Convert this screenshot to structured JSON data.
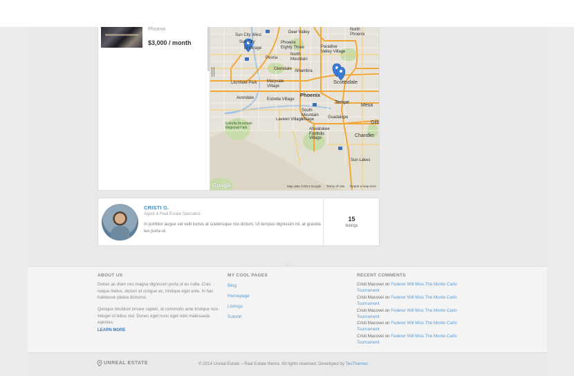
{
  "listing": {
    "location": "Phoenix",
    "price": "$3,000 / month"
  },
  "map": {
    "labels": {
      "sun_city_west": "Sun City West",
      "sun_city": "Sun City",
      "deer_valley": "Deer Valley",
      "north_phoenix": "North\nPhoenix",
      "phoenix_eighty_three": "Phoenix\nEighty Three",
      "paradise_valley_village": "Paradise\nValley Village",
      "el_mirage": "El Mirage",
      "peoria": "Peoria",
      "north_mountain": "North\nMountain",
      "glendale": "Glendale",
      "alhambra": "Alhambra",
      "scottsdale": "Scottsdale",
      "litchfield_park": "Litchfield Park",
      "maryvale_village": "Maryvale\nVillage",
      "phoenix": "Phoenix",
      "avondale": "Avondale",
      "estrella_village": "Estrella Village",
      "tempe": "Tempe",
      "mesa": "Mesa",
      "south_mountain_village": "South\nMountain\nVillage",
      "laveen_village": "Laveen Village",
      "guadalupe": "Guadalupe",
      "estrella_mountain_regional_park": "Estrella Mountain\nRegional Park",
      "ahwatukee_foothills_village": "Ahwatukee\nFoothills\nVillage",
      "chandler": "Chandler",
      "gilbert": "Gilb",
      "sun_lakes": "Sun Lakes"
    },
    "map_data": "Map data ©2014 Google",
    "terms": "Terms of Use",
    "report": "Report a map error",
    "logo": "Google"
  },
  "agent": {
    "name": "CRISTI G.",
    "role": "Agent & Real Estate Specialist",
    "bio": "In porttitor augue vel velit luctus at scelerisque nisi dictum. Ut tempus dignissim mi, at gravida leo porta ut.",
    "listings_count": "15",
    "listings_label": "listings"
  },
  "footer": {
    "about_title": "ABOUT US",
    "about_p1": "Donec ac diam nec magna dignissim porta ut eu nulla. Cras neque metus, dictum et congue ac, tristique eget ante. In hac habitasse platea dictumst.",
    "about_p2": "Quisque tincidunt ornare sapien, at commodo ante tristique non. Integer id tellus nisl. Donec eget nunc eget odio malesuada egestas.",
    "learn_more": "LEARN MORE",
    "pages_title": "MY COOL PAGES",
    "pages": [
      "Blog",
      "Homepage",
      "Listings",
      "Submit"
    ],
    "comments_title": "RECENT COMMENTS",
    "comments": [
      {
        "author": "Cristi Macovei",
        "on": "on",
        "post": "Federer Will Miss The Monte Carlo Tournament"
      },
      {
        "author": "Cristi Macovei",
        "on": "on",
        "post": "Federer Will Miss The Monte Carlo Tournament"
      },
      {
        "author": "Cristi Macovei",
        "on": "on",
        "post": "Federer Will Miss The Monte Carlo Tournament"
      },
      {
        "author": "Cristi Macovei",
        "on": "on",
        "post": "Federer Will Miss The Monte Carlo Tournament"
      },
      {
        "author": "Cristi Macovei",
        "on": "on",
        "post": "Federer Will Miss The Monte Carlo Tournament"
      }
    ],
    "brand": "UNREAL ESTATE",
    "copyright": "© 2014 Unreal Estate – Real Estate theme. All rights reserved. Developed by",
    "developer": "TeoThemes"
  }
}
